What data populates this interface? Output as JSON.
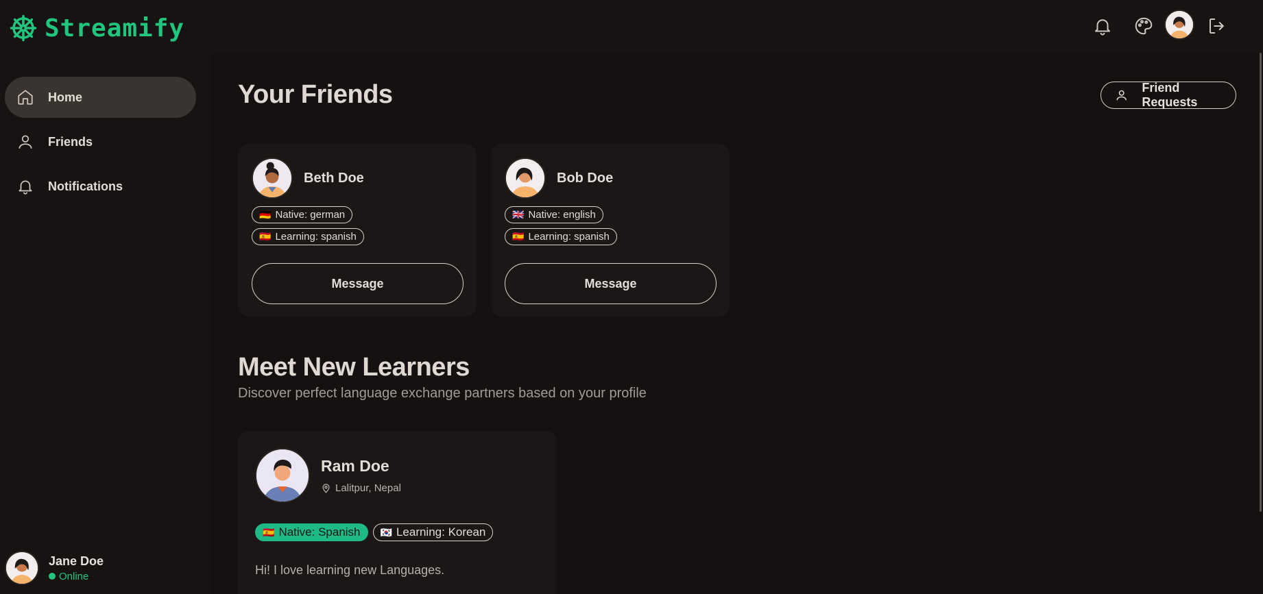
{
  "app": {
    "name": "Streamify"
  },
  "sidebar": {
    "items": [
      {
        "label": "Home",
        "icon": "home-icon",
        "active": true
      },
      {
        "label": "Friends",
        "icon": "user-icon",
        "active": false
      },
      {
        "label": "Notifications",
        "icon": "bell-icon",
        "active": false
      }
    ],
    "user": {
      "name": "Jane Doe",
      "status": "Online"
    }
  },
  "header": {
    "icons": [
      "bell-icon",
      "palette-icon",
      "avatar",
      "logout-icon"
    ]
  },
  "friends": {
    "title": "Your Friends",
    "requests_label": "Friend Requests",
    "cards": [
      {
        "name": "Beth Doe",
        "native": "Native: german",
        "native_flag": "🇩🇪",
        "learning": "Learning: spanish",
        "learning_flag": "🇪🇸",
        "button": "Message"
      },
      {
        "name": "Bob Doe",
        "native": "Native: english",
        "native_flag": "🇬🇧",
        "learning": "Learning: spanish",
        "learning_flag": "🇪🇸",
        "button": "Message"
      }
    ]
  },
  "learners": {
    "title": "Meet New Learners",
    "subtitle": "Discover perfect language exchange partners based on your profile",
    "cards": [
      {
        "name": "Ram Doe",
        "location": "Lalitpur, Nepal",
        "native": "Native: Spanish",
        "native_flag": "🇪🇸",
        "learning": "Learning: Korean",
        "learning_flag": "🇰🇷",
        "bio": "Hi! I love learning new Languages."
      }
    ]
  },
  "colors": {
    "accent": "#22c57e",
    "background": "#141110",
    "card": "#1b1716",
    "pill_filled": "#1fb985"
  }
}
